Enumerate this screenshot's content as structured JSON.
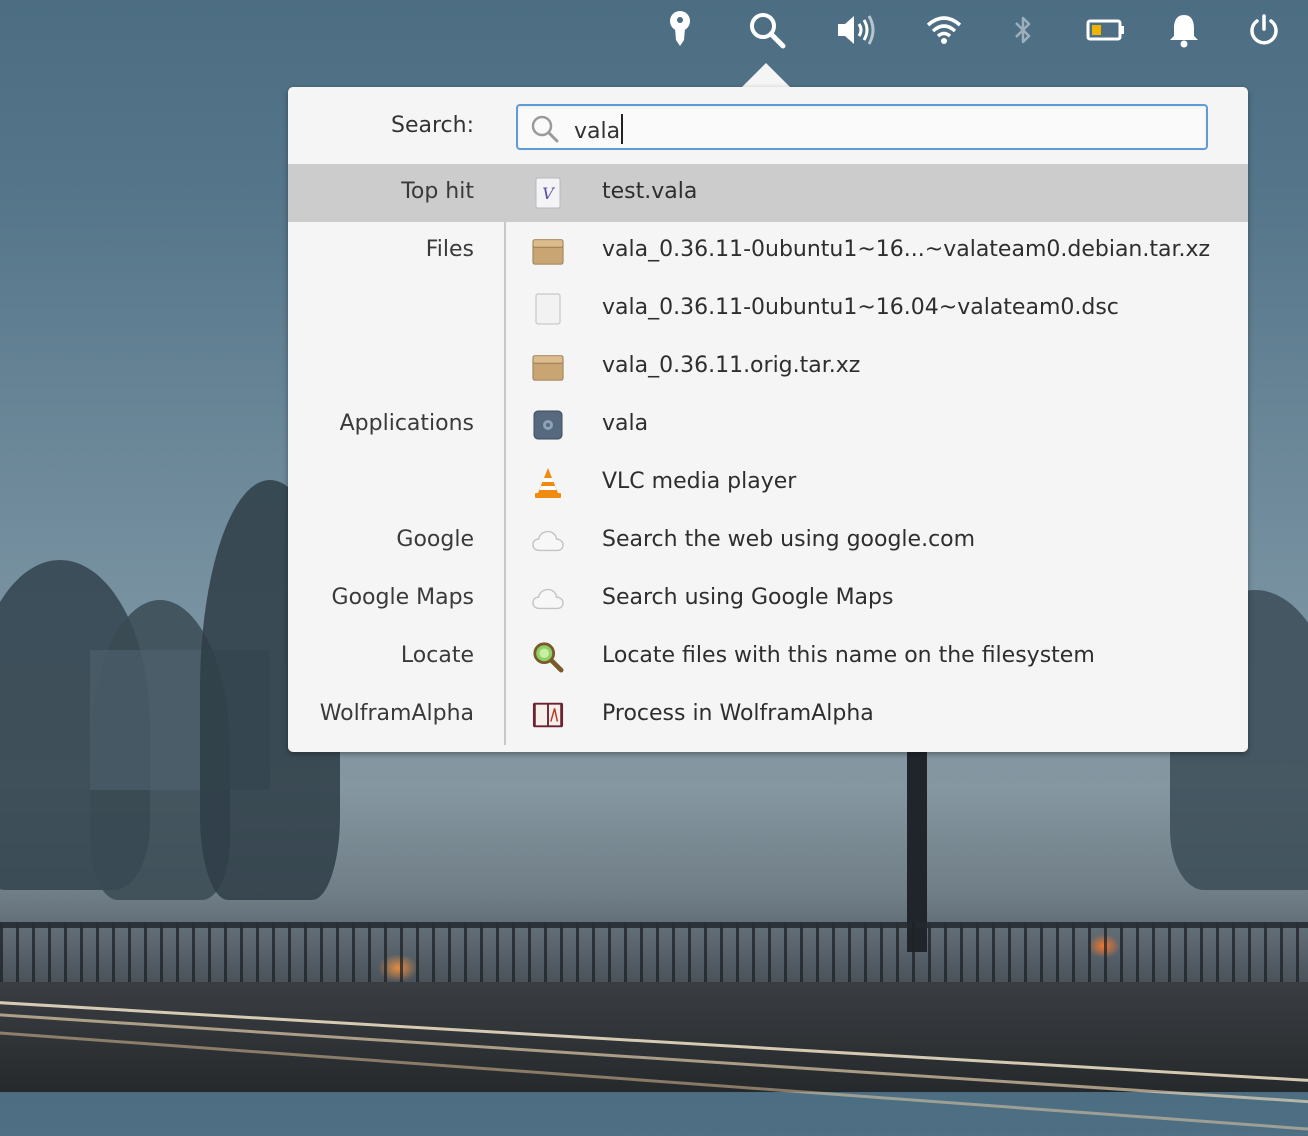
{
  "panel": {
    "indicators": [
      {
        "name": "keyring-icon"
      },
      {
        "name": "search-icon"
      },
      {
        "name": "volume-icon"
      },
      {
        "name": "wifi-icon"
      },
      {
        "name": "bluetooth-icon"
      },
      {
        "name": "battery-icon"
      },
      {
        "name": "notifications-icon"
      },
      {
        "name": "power-icon"
      }
    ]
  },
  "search": {
    "label": "Search:",
    "query": "vala"
  },
  "results": [
    {
      "category": "Top hit",
      "title": "test.vala",
      "icon": "vala-file-icon",
      "selected": true
    },
    {
      "category": "Files",
      "title": "vala_0.36.11-0ubuntu1~16...~valateam0.debian.tar.xz",
      "icon": "archive-icon"
    },
    {
      "category": "",
      "title": "vala_0.36.11-0ubuntu1~16.04~valateam0.dsc",
      "icon": "document-icon"
    },
    {
      "category": "",
      "title": "vala_0.36.11.orig.tar.xz",
      "icon": "archive-icon"
    },
    {
      "category": "Applications",
      "title": "vala",
      "icon": "application-icon"
    },
    {
      "category": "",
      "title": "VLC media player",
      "icon": "vlc-icon"
    },
    {
      "category": "Google",
      "title": "Search the web using google.com",
      "icon": "cloud-icon"
    },
    {
      "category": "Google Maps",
      "title": "Search using Google Maps",
      "icon": "cloud-icon"
    },
    {
      "category": "Locate",
      "title": "Locate files with this name on the filesystem",
      "icon": "locate-icon"
    },
    {
      "category": "WolframAlpha",
      "title": "Process in WolframAlpha",
      "icon": "book-icon"
    }
  ],
  "colors": {
    "accent": "#5f9bd8",
    "selection": "#cccccc",
    "battery_level": "#f0b400"
  }
}
